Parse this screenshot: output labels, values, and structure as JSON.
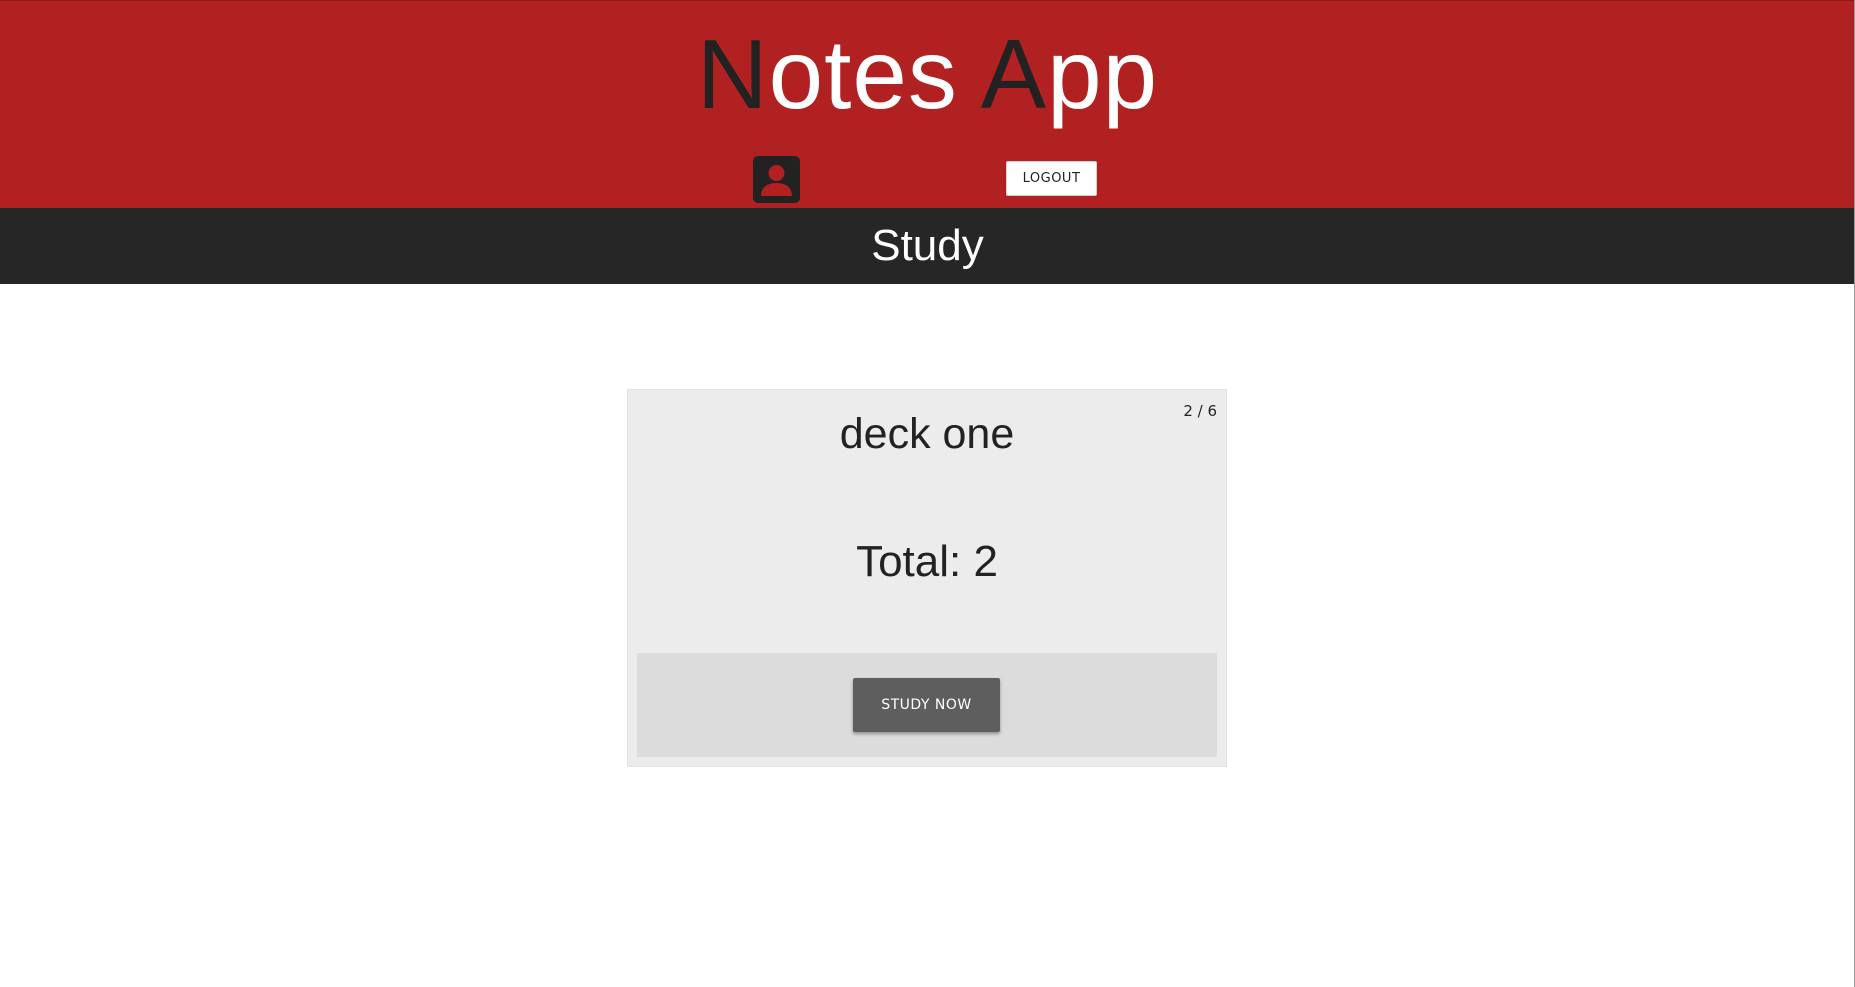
{
  "header": {
    "title_dark_1": "N",
    "title_light_1": "otes ",
    "title_dark_2": "A",
    "title_light_2": "pp",
    "account_icon": "account-box-icon",
    "logout_label": "LOGOUT",
    "background_color": "#b22121"
  },
  "subheader": {
    "title": "Study",
    "background_color": "#262626"
  },
  "deck_card": {
    "name": "deck one",
    "counter": "2 / 6",
    "total": "Total: 2",
    "study_button_label": "STUDY NOW",
    "card_color": "#ececec",
    "footer_color": "#dcdcdc",
    "button_color": "#5e5e5e"
  }
}
